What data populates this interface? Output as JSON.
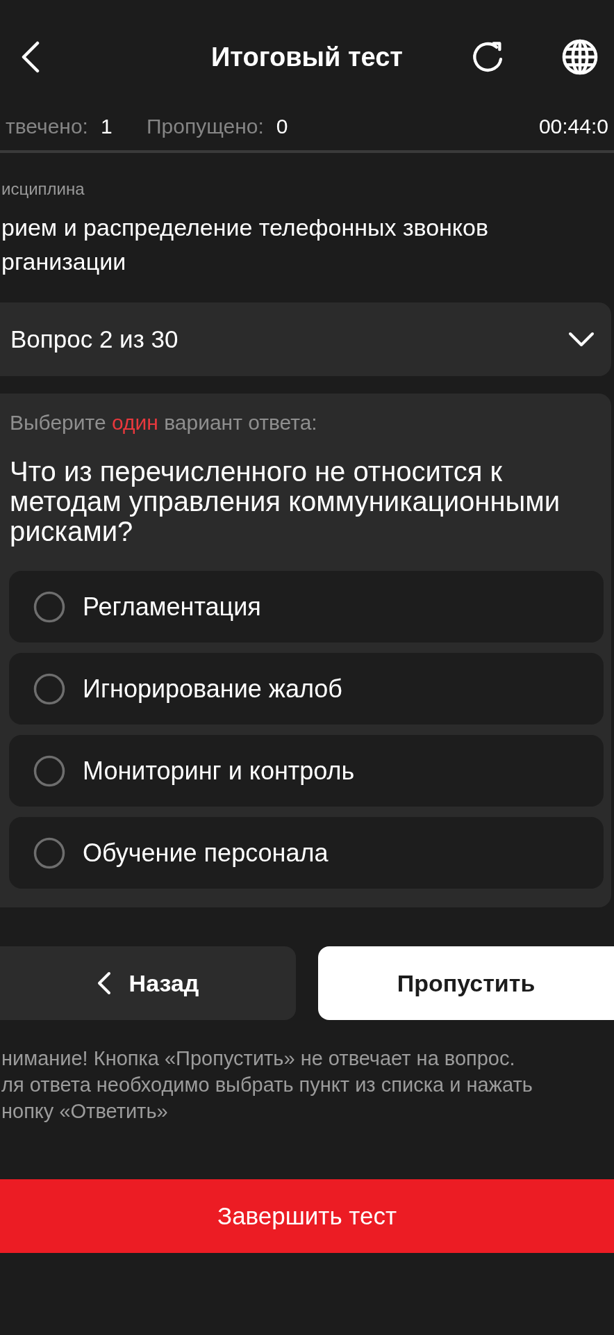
{
  "header": {
    "title": "Итоговый тест"
  },
  "stats": [
    {
      "label": "твечено:",
      "value": "1"
    },
    {
      "label": "Пропущено:",
      "value": "0"
    }
  ],
  "timer": "00:44:0",
  "discipline": {
    "label": "исциплина",
    "title_lines": [
      "рием и распределение телефонных звонков",
      "рганизации"
    ]
  },
  "question_selector": {
    "label": "Вопрос 2 из 30",
    "expanded": false
  },
  "question": {
    "instruction": {
      "before": "Выберите",
      "highlight": "один",
      "after": "вариант ответа:"
    },
    "text": "Что из перечисленного не относится к методам управления коммуникационными рисками?",
    "options": [
      {
        "label": "Регламентация",
        "selected": false
      },
      {
        "label": "Игнорирование жалоб",
        "selected": false
      },
      {
        "label": "Мониторинг и контроль",
        "selected": false
      },
      {
        "label": "Обучение персонала",
        "selected": false
      }
    ]
  },
  "buttons": [
    {
      "kind": "back",
      "label": "Назад"
    },
    {
      "kind": "skip",
      "label": "Пропустить"
    }
  ],
  "notice_lines": [
    "нимание! Кнопка «Пропустить» не отвечает на вопрос.",
    "ля ответа необходимо выбрать пункт из списка и нажать",
    "нопку «Ответить»"
  ],
  "finish_button": {
    "label": "Завершить тест"
  }
}
